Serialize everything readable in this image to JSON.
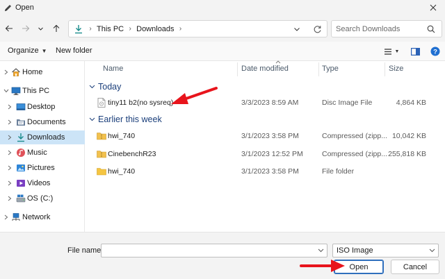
{
  "window": {
    "title": "Open"
  },
  "address": {
    "crumbs": [
      "This PC",
      "Downloads"
    ]
  },
  "search": {
    "placeholder": "Search Downloads"
  },
  "toolbar": {
    "organize": "Organize",
    "new_folder": "New folder"
  },
  "sidebar": {
    "items": [
      {
        "label": "Home",
        "icon": "home-icon"
      },
      {
        "label": "This PC",
        "icon": "computer-icon"
      },
      {
        "label": "Desktop",
        "icon": "desktop-icon"
      },
      {
        "label": "Documents",
        "icon": "documents-icon"
      },
      {
        "label": "Downloads",
        "icon": "download-icon",
        "selected": true
      },
      {
        "label": "Music",
        "icon": "music-icon"
      },
      {
        "label": "Pictures",
        "icon": "pictures-icon"
      },
      {
        "label": "Videos",
        "icon": "videos-icon"
      },
      {
        "label": "OS (C:)",
        "icon": "drive-icon"
      },
      {
        "label": "Network",
        "icon": "network-icon"
      }
    ]
  },
  "columns": {
    "name": "Name",
    "date": "Date modified",
    "type": "Type",
    "size": "Size"
  },
  "groups": [
    {
      "label": "Today",
      "files": [
        {
          "name": "tiny11 b2(no sysreq)",
          "date": "3/3/2023 8:59 AM",
          "type": "Disc Image File",
          "size": "4,864 KB",
          "icon": "disc-image-file-icon"
        }
      ]
    },
    {
      "label": "Earlier this week",
      "files": [
        {
          "name": "hwi_740",
          "date": "3/1/2023 3:58 PM",
          "type": "Compressed (zipp...",
          "size": "10,042 KB",
          "icon": "zip-folder-icon"
        },
        {
          "name": "CinebenchR23",
          "date": "3/1/2023 12:52 PM",
          "type": "Compressed (zipp...",
          "size": "255,818 KB",
          "icon": "zip-folder-icon"
        },
        {
          "name": "hwi_740",
          "date": "3/1/2023 3:58 PM",
          "type": "File folder",
          "size": "",
          "icon": "folder-icon"
        }
      ]
    }
  ],
  "footer": {
    "file_name_label": "File name:",
    "file_name_value": "",
    "file_type": "ISO Image",
    "open_label": "Open",
    "cancel_label": "Cancel"
  },
  "colors": {
    "selection": "#cce4f7",
    "accent": "#2f6fbd",
    "annotation_arrow": "#e8141c",
    "group_header": "#1a3e7a"
  }
}
